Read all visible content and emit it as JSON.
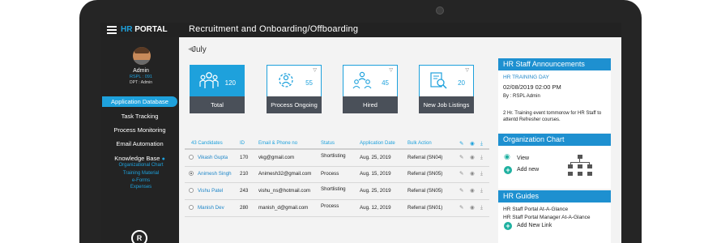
{
  "app": {
    "brand_hr": "HR",
    "brand_rest": " PORTAL",
    "page_title": "Recruitment and Onboarding/Offboarding"
  },
  "user": {
    "name": "Admin",
    "role": "RSPL : 091",
    "dept": "DPT : Admin"
  },
  "sidebar": {
    "items": [
      "Application Database",
      "Task Tracking",
      "Process Monitoring",
      "Email Automation",
      "Knowledge Base"
    ],
    "knowledge_sub": [
      "Organizational Chart",
      "Training Material",
      "e-Forms",
      "Expenses"
    ],
    "logo_text": "R"
  },
  "month": {
    "label": "July",
    "prev": "◀",
    "next": "▶"
  },
  "cards": [
    {
      "label": "Total",
      "count": "120",
      "icon": "group-icon",
      "active": true
    },
    {
      "label": "Process Ongoing",
      "count": "55",
      "icon": "process-gear-icon",
      "active": false
    },
    {
      "label": "Hired",
      "count": "45",
      "icon": "hired-team-icon",
      "active": false
    },
    {
      "label": "New Job Listings",
      "count": "20",
      "icon": "job-search-icon",
      "active": false
    }
  ],
  "filter_glyph": "▽",
  "table": {
    "headers": [
      "43 Candidates",
      "ID",
      "Email & Phone no",
      "Status",
      "Application Date",
      "Bulk Action"
    ],
    "rows": [
      {
        "name": "Vikash Gupta",
        "id": "170",
        "email": "vkg@gmail.com",
        "status": "Shortlisting",
        "date": "Aug. 25, 2019",
        "action": "Referral (SN04)"
      },
      {
        "name": "Animesh Singh",
        "id": "210",
        "email": "Animesh32@gmail.com",
        "status": "Process",
        "date": "Aug. 15, 2019",
        "action": "Referral (SN05)"
      },
      {
        "name": "Vishu Patel",
        "id": "243",
        "email": "vishu_ns@hotmail.com",
        "status": "Shortlisting",
        "date": "Aug. 25, 2019",
        "action": "Referral (SN05)"
      },
      {
        "name": "Manish Dev",
        "id": "280",
        "email": "manish_d@gmail.com",
        "status": "Process",
        "date": "Aug. 12, 2019",
        "action": "Referral (SN01)"
      }
    ],
    "icons": {
      "edit": "✎",
      "view": "◉",
      "download": "⤓"
    }
  },
  "announcements": {
    "header": "HR Staff Announcements",
    "title": "HR TRAINING DAY",
    "date": "02/08/2019 02:00 PM",
    "by": "By : RSPL Admin",
    "body": "2 Hr. Training event tommorow for HR Staff to attentd Refresher courses."
  },
  "org_chart": {
    "header": "Organization Chart",
    "view": "View",
    "add": "Add new"
  },
  "guides": {
    "header": "HR Guides",
    "links": [
      "HR Staff Portal At-A-Glance",
      "HR Staff Portal  Manager At-A-Glance"
    ],
    "add": "Add New Link"
  },
  "colors": {
    "accent": "#1ea1dc",
    "dark": "#232323",
    "card_label_bg": "#4a5059",
    "teal": "#1eb0a0"
  }
}
